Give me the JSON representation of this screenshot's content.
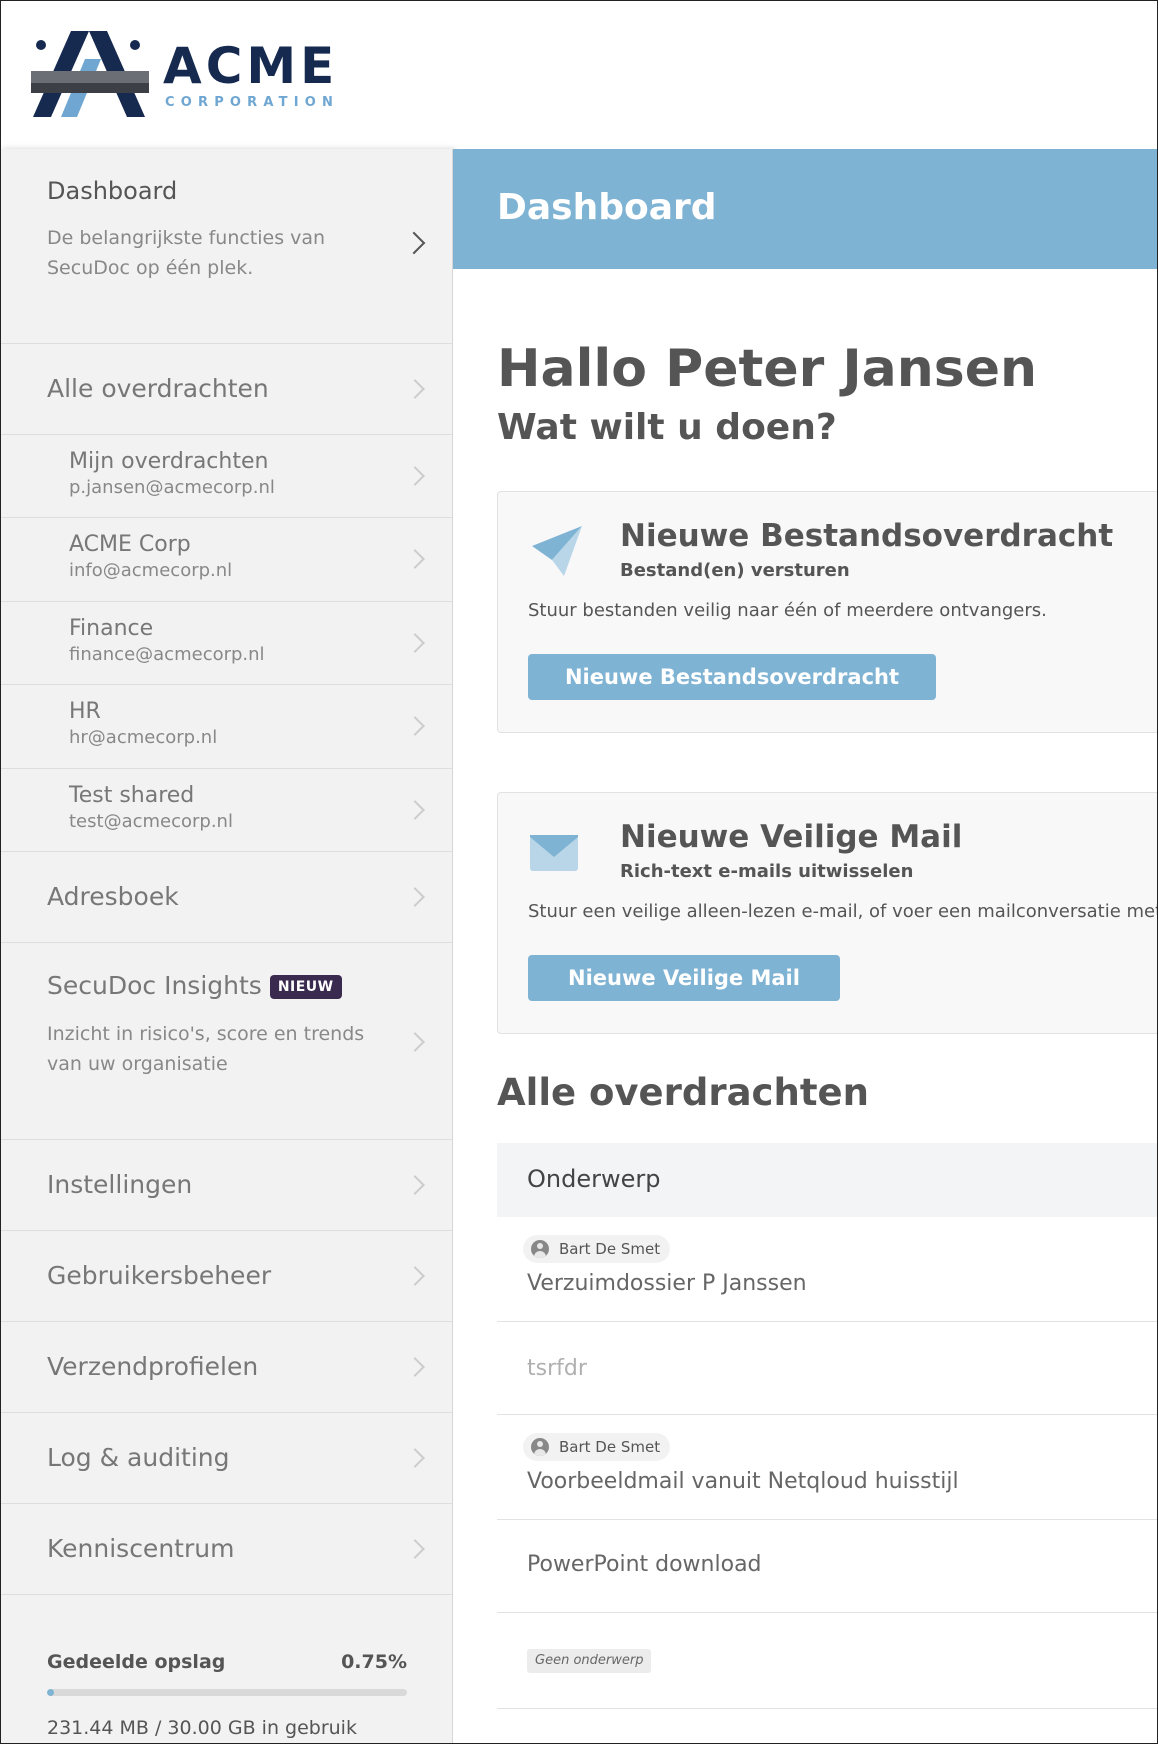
{
  "logo": {
    "wordmark": "ACME",
    "tagline": "CORPORATION"
  },
  "sidebar": {
    "dashboard": {
      "title": "Dashboard",
      "description": "De belangrijkste functies van SecuDoc op één plek."
    },
    "all_transfers": "Alle overdrachten",
    "mailboxes": [
      {
        "name": "Mijn overdrachten",
        "email": "p.jansen@acmecorp.nl"
      },
      {
        "name": "ACME Corp",
        "email": "info@acmecorp.nl"
      },
      {
        "name": "Finance",
        "email": "finance@acmecorp.nl"
      },
      {
        "name": "HR",
        "email": "hr@acmecorp.nl"
      },
      {
        "name": "Test shared",
        "email": "test@acmecorp.nl"
      }
    ],
    "address_book": "Adresboek",
    "insights": {
      "title": "SecuDoc Insights",
      "badge": "NIEUW",
      "description": "Inzicht in risico's, score en trends van uw organisatie"
    },
    "settings": "Instellingen",
    "user_management": "Gebruikersbeheer",
    "send_profiles": "Verzendprofielen",
    "log_auditing": "Log & auditing",
    "knowledge_center": "Kenniscentrum",
    "storage": {
      "label": "Gedeelde opslag",
      "percent_text": "0.75%",
      "fraction_used": 0.0075,
      "usage": "231.44 MB / 30.00 GB in gebruik"
    }
  },
  "main": {
    "banner_title": "Dashboard",
    "greeting": "Hallo Peter Jansen",
    "question": "Wat wilt u doen?",
    "cards": [
      {
        "icon": "paper-plane-icon",
        "title": "Nieuwe Bestandsoverdracht",
        "subtitle": "Bestand(en) versturen",
        "text": "Stuur bestanden veilig naar één of meerdere ontvangers.",
        "button": "Nieuwe Bestandsoverdracht"
      },
      {
        "icon": "envelope-icon",
        "title": "Nieuwe Veilige Mail",
        "subtitle": "Rich-text e-mails uitwisselen",
        "text": "Stuur een veilige alleen-lezen e-mail, of voer een mailconversatie met",
        "button": "Nieuwe Veilige Mail"
      }
    ],
    "transfers_title": "Alle overdrachten",
    "table": {
      "column": "Onderwerp",
      "rows": [
        {
          "sender": "Bart De Smet",
          "subject": "Verzuimdossier P Janssen"
        },
        {
          "sender": "",
          "subject": "tsrfdr"
        },
        {
          "sender": "Bart De Smet",
          "subject": "Voorbeeldmail vanuit Netqloud huisstijl"
        },
        {
          "sender": "",
          "subject": "PowerPoint download"
        },
        {
          "sender": "",
          "subject": "Geen onderwerp"
        }
      ]
    }
  },
  "colors": {
    "accent": "#7fb3d3",
    "brand_navy": "#16294f",
    "badge": "#3b2a4f"
  }
}
